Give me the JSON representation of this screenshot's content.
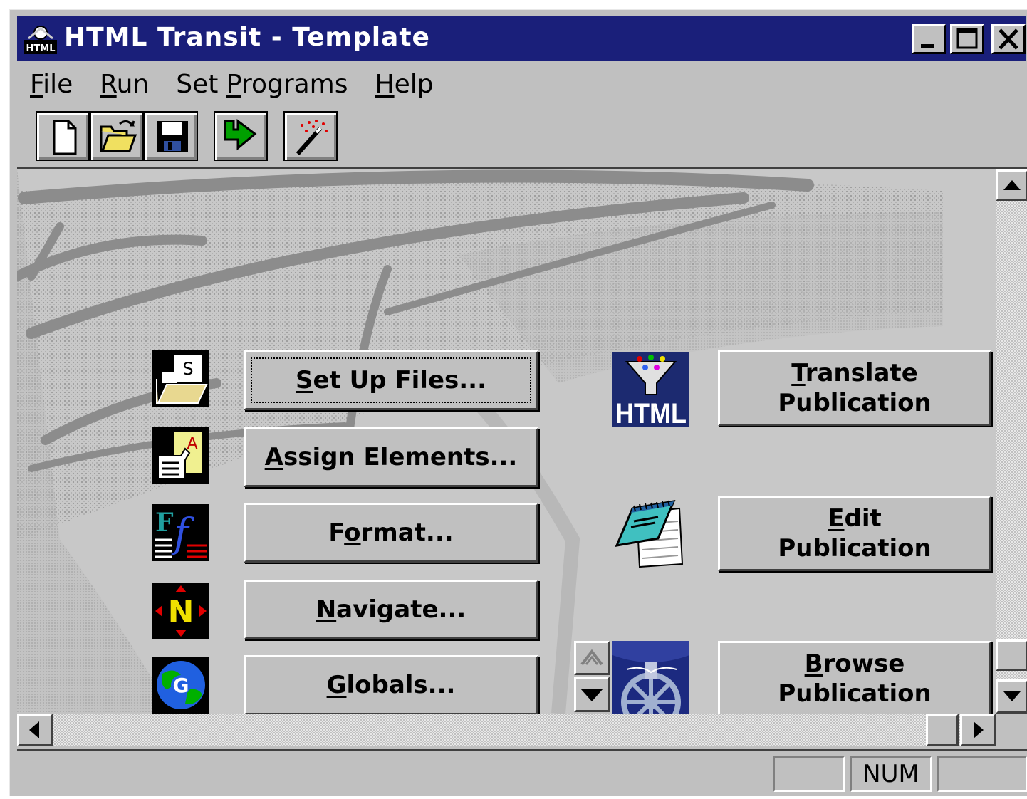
{
  "window": {
    "title": "HTML Transit - Template",
    "colors": {
      "titlebar": "#1a1f7a",
      "face": "#c0c0c0"
    }
  },
  "menu": [
    {
      "prefix": "",
      "mnemonic": "F",
      "rest": "ile"
    },
    {
      "prefix": "",
      "mnemonic": "R",
      "rest": "un"
    },
    {
      "prefix": "Set ",
      "mnemonic": "P",
      "rest": "rograms"
    },
    {
      "prefix": "",
      "mnemonic": "H",
      "rest": "elp"
    }
  ],
  "toolbar": [
    {
      "icon": "new-document-icon"
    },
    {
      "icon": "open-folder-icon"
    },
    {
      "icon": "save-disk-icon"
    },
    {
      "icon": "run-arrow-icon"
    },
    {
      "icon": "magic-wand-icon"
    }
  ],
  "left_steps": [
    {
      "icon": "set-up-files-icon",
      "mnemonic": "S",
      "rest": "et Up Files..."
    },
    {
      "icon": "assign-elements-icon",
      "mnemonic": "A",
      "rest": "ssign Elements..."
    },
    {
      "icon": "format-icon",
      "pre": "F",
      "mnemonic": "o",
      "rest": "rmat..."
    },
    {
      "icon": "navigate-icon",
      "mnemonic": "N",
      "rest": "avigate..."
    },
    {
      "icon": "globals-icon",
      "mnemonic": "G",
      "rest": "lobals..."
    }
  ],
  "right_actions": [
    {
      "icon": "html-funnel-icon",
      "mnemonic": "T",
      "line1_rest": "ranslate",
      "line2": "Publication"
    },
    {
      "icon": "notepad-icon",
      "mnemonic": "E",
      "line1_rest": "dit",
      "line2": "Publication"
    },
    {
      "icon": "ship-wheel-icon",
      "mnemonic": "B",
      "line1_rest": "rowse",
      "line2": "Publication"
    }
  ],
  "status": {
    "pane1": "",
    "pane2": "NUM",
    "pane3": ""
  }
}
